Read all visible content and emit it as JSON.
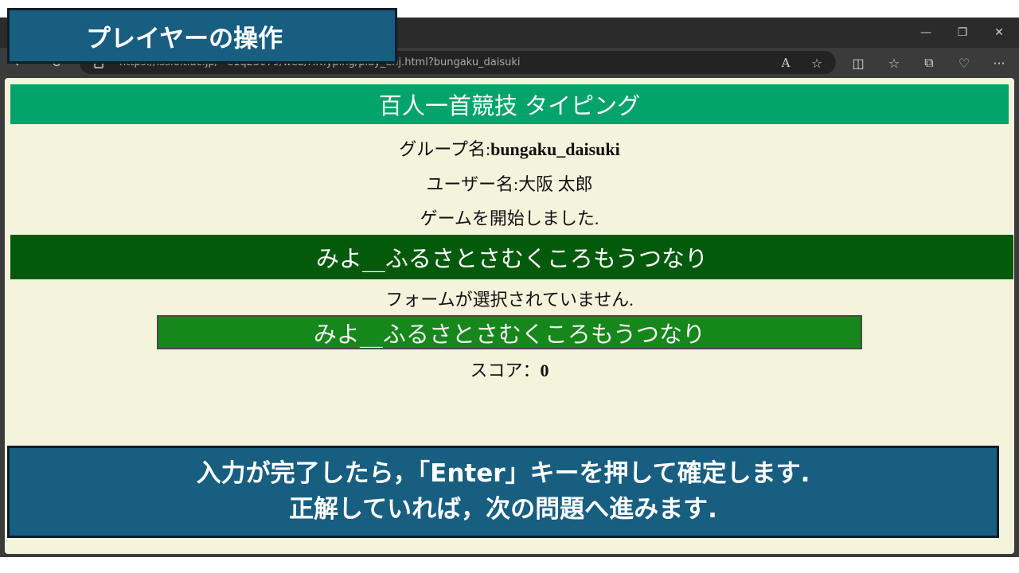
{
  "browser": {
    "url": "https://lss.oit.ac.jp/~e1q23079/web/HKTyping/play_enj.html?bungaku_daisuki",
    "window_controls": {
      "minimize": "—",
      "restore": "❐",
      "close": "✕"
    },
    "nav": {
      "back": "←",
      "reload": "↻"
    },
    "toolbar_icons": {
      "read_aloud": "A",
      "favorite": "☆",
      "split": "◫",
      "favorites": "☆",
      "collections": "⧉",
      "health": "♡",
      "more": "···"
    }
  },
  "app": {
    "title": "百人一首競技 タイピング",
    "group_label": "グループ名:",
    "group_name": "bungaku_daisuki",
    "user_label": "ユーザー名:",
    "user_name": "大阪 太郎",
    "game_status": "ゲームを開始しました.",
    "question": "みよ__ふるさとさむくころもうつなり",
    "form_status": "フォームが選択されていません.",
    "answer_value": "みよ__ふるさとさむくころもうつなり",
    "score_label": "スコア：",
    "score_value": "0"
  },
  "overlay": {
    "title": "プレイヤーの操作",
    "instruction_line1": "入力が完了したら，「Enter」キーを押して確定します.",
    "instruction_line2": "正解していれば，次の問題へ進みます."
  },
  "colors": {
    "header_green": "#03a46b",
    "question_green": "#045a0b",
    "answer_green": "#16871a",
    "page_bg": "#f4f3dc",
    "overlay_blue": "#175e81"
  }
}
